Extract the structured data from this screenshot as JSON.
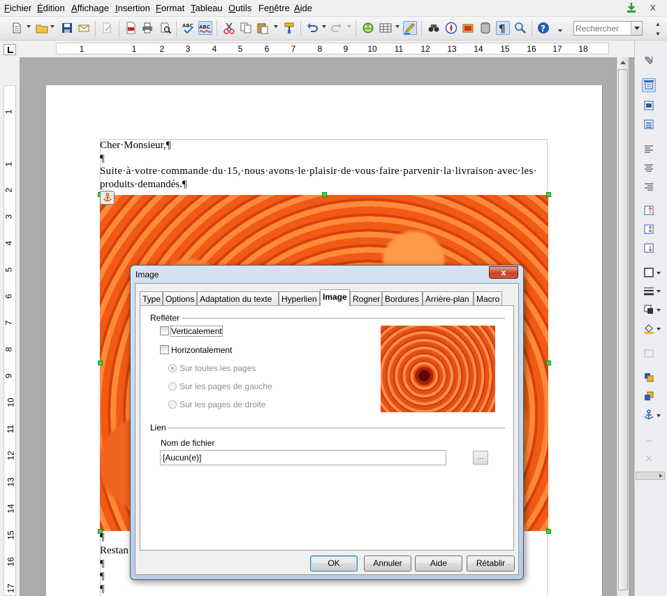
{
  "menu": {
    "items": [
      {
        "text": "Fichier",
        "key": "F",
        "rest": "ichier"
      },
      {
        "text": "Édition",
        "key": "É",
        "rest": "dition"
      },
      {
        "text": "Affichage",
        "key": "A",
        "rest": "ffichage"
      },
      {
        "text": "Insertion",
        "key": "I",
        "rest": "nsertion"
      },
      {
        "text": "Format",
        "key": "F",
        "rest": "ormat"
      },
      {
        "text": "Tableau",
        "key": "T",
        "rest": "ableau"
      },
      {
        "text": "Outils",
        "key": "O",
        "rest": "utils"
      },
      {
        "text": "Fenêtre",
        "key": "n",
        "pre": "Fe",
        "rest": "être"
      },
      {
        "text": "Aide",
        "key": "A",
        "rest": "ide"
      }
    ],
    "close_glyph": "x"
  },
  "toolbar": {
    "search_placeholder": "Rechercher",
    "icons": [
      "new-document-icon",
      "open-folder-icon",
      "save-icon",
      "email-icon",
      "edit-file-icon",
      "export-pdf-icon",
      "print-icon",
      "print-preview-icon",
      "spellcheck-icon",
      "autospellcheck-icon",
      "cut-icon",
      "copy-icon",
      "paste-icon",
      "clone-format-icon",
      "undo-icon",
      "redo-icon",
      "gallery-icon",
      "table-icon",
      "draw-functions-icon",
      "find-replace-icon",
      "navigator-icon",
      "gallery-image-icon",
      "data-sources-icon",
      "formatting-marks-icon",
      "zoom-icon",
      "help-icon"
    ]
  },
  "ruler": {
    "h_numbers": [
      "1",
      "1",
      "2",
      "3",
      "4",
      "5",
      "6",
      "7",
      "8",
      "9",
      "10",
      "11",
      "12",
      "13",
      "14",
      "15",
      "16",
      "17",
      "18"
    ],
    "v_numbers": [
      "1",
      "1",
      "2",
      "3",
      "4",
      "5",
      "6",
      "7",
      "8",
      "9",
      "10",
      "11",
      "12",
      "13",
      "14",
      "15",
      "16",
      "17"
    ]
  },
  "document": {
    "lines": [
      "Cher·Monsieur,¶",
      "¶",
      "Suite·à·votre·commande·du·15,·nous·avons·le·plaisir·de·vous·faire·parvenir·la·livraison·avec·les·",
      "produits·demandés.¶"
    ],
    "after_image_lines": [
      "¶",
      "Restan",
      "¶",
      "¶",
      "¶"
    ]
  },
  "dialog": {
    "title": "Image",
    "close_glyph": "x",
    "tabs": [
      "Type",
      "Options",
      "Adaptation du texte",
      "Hyperlien",
      "Image",
      "Rogner",
      "Bordures",
      "Arrière-plan",
      "Macro"
    ],
    "active_tab": "Image",
    "mirror_group": "Refléter",
    "vertical_label": "Verticalement",
    "horizontal_label": "Horizontalement",
    "radio_all": "Sur toutes les pages",
    "radio_left": "Sur les pages de gauche",
    "radio_right": "Sur les pages de droite",
    "link_group": "Lien",
    "filename_label": "Nom de fichier",
    "filename_value": "[Aucun(e)]",
    "browse_label": "...",
    "buttons": {
      "ok": "OK",
      "cancel": "Annuler",
      "help": "Aide",
      "reset": "Rétablir"
    }
  },
  "colors": {
    "accent": "#3c7fb1",
    "photo": "#f2661c",
    "handle": "#3ed63e"
  }
}
